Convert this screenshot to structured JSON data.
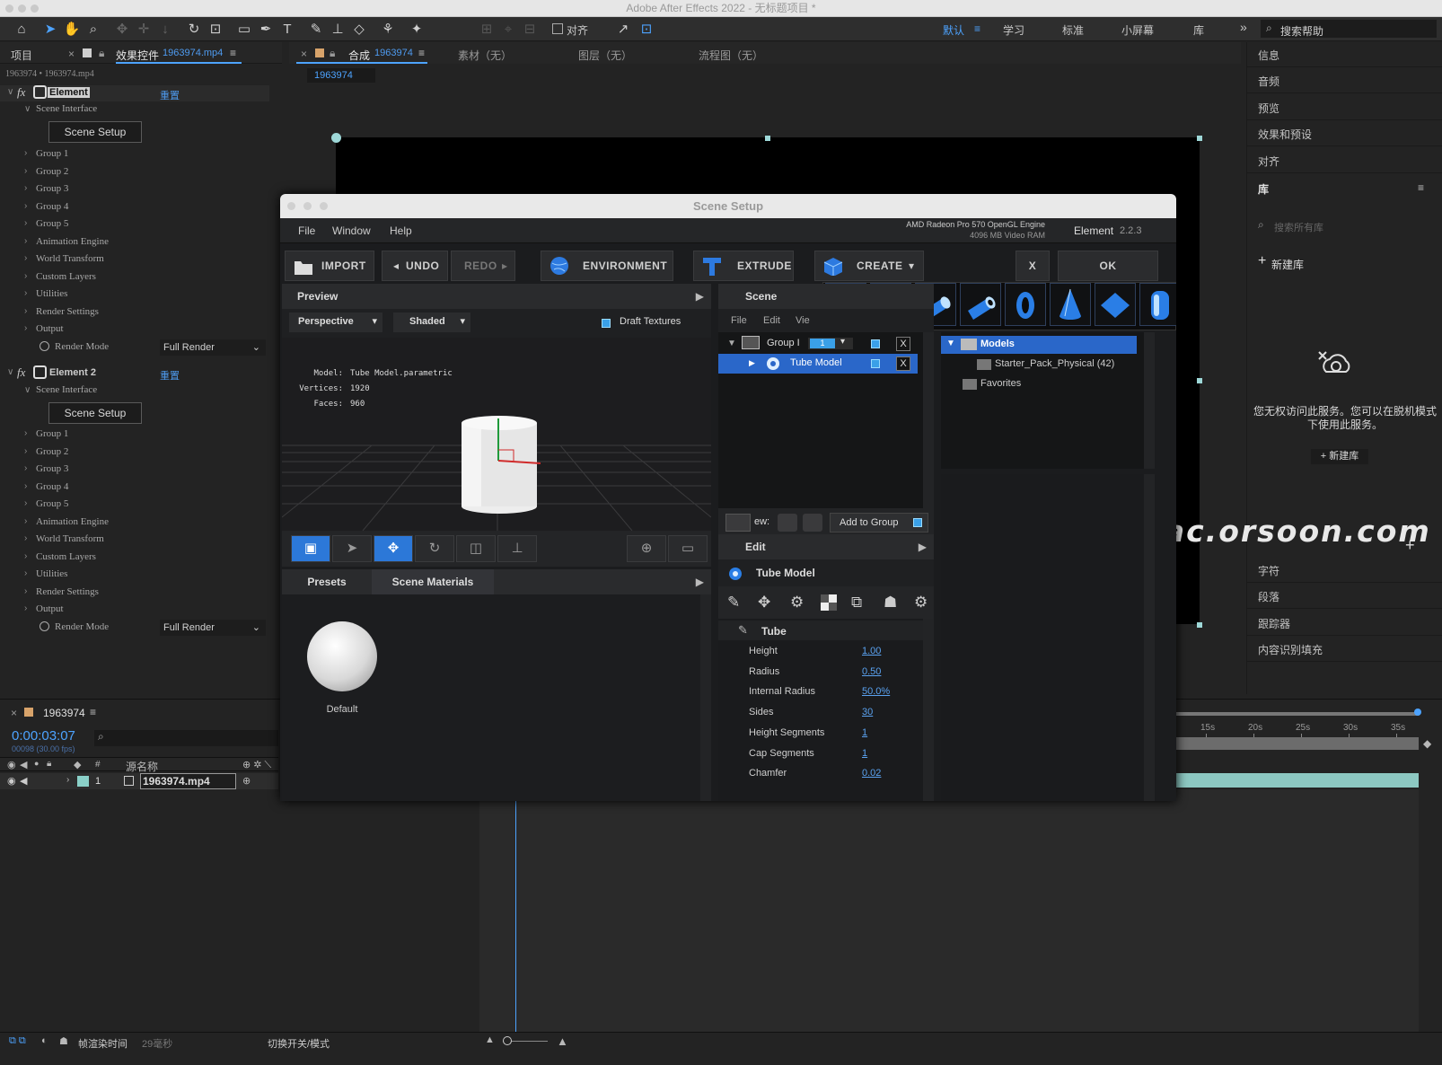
{
  "app": {
    "title": "Adobe After Effects 2022 - 无标题项目 *"
  },
  "toolbar": {
    "align_label": "对齐",
    "workspaces": [
      "默认",
      "学习",
      "标准",
      "小屏幕",
      "库"
    ],
    "more": "»",
    "search_placeholder": "搜索帮助"
  },
  "left_panel": {
    "tab_project": "项目",
    "tab_effects": "效果控件",
    "tab_effects_file": "1963974.mp4",
    "breadcrumb": "1963974 • 1963974.mp4",
    "element1": {
      "name": "Element",
      "reset": "重置",
      "scene_interface": "Scene Interface",
      "scene_setup": "Scene Setup",
      "items": [
        "Group 1",
        "Group 2",
        "Group 3",
        "Group 4",
        "Group 5",
        "Animation Engine",
        "World Transform",
        "Custom Layers",
        "Utilities",
        "Render Settings",
        "Output"
      ],
      "render_mode_label": "Render Mode",
      "render_mode_value": "Full Render"
    },
    "element2": {
      "name": "Element 2",
      "reset": "重置",
      "scene_interface": "Scene Interface",
      "scene_setup": "Scene Setup",
      "items": [
        "Group 1",
        "Group 2",
        "Group 3",
        "Group 4",
        "Group 5",
        "Animation Engine",
        "World Transform",
        "Custom Layers",
        "Utilities",
        "Render Settings",
        "Output"
      ],
      "render_mode_label": "Render Mode",
      "render_mode_value": "Full Render"
    }
  },
  "comp": {
    "tab_comp": "合成",
    "tab_comp_name": "1963974",
    "tab_footage": "素材（无）",
    "tab_layer": "图层（无）",
    "tab_flow": "流程图（无）",
    "comp_chip": "1963974"
  },
  "right_panel": {
    "items_top": [
      "信息",
      "音频",
      "预览",
      "效果和预设",
      "对齐"
    ],
    "library_title": "库",
    "library_search_placeholder": "搜索所有库",
    "new_library": "新建库",
    "no_access_text": "您无权访问此服务。您可以在脱机模式下使用此服务。",
    "new_library_btn": "+ 新建库",
    "items_bottom": [
      "字符",
      "段落",
      "跟踪器",
      "内容识别填充"
    ]
  },
  "timeline": {
    "comp_name": "1963974",
    "timecode": "0:00:03:07",
    "fps": "00098 (30.00 fps)",
    "col_num": "#",
    "col_source": "源名称",
    "layer_num": "1",
    "layer_name": "1963974.mp4",
    "ruler": [
      "15s",
      "20s",
      "25s",
      "30s",
      "35s"
    ],
    "bottom_label": "帧渲染时间",
    "bottom_time": "29毫秒",
    "bottom_toggle": "切换开关/模式"
  },
  "watermark": "Mac.orsoon.com",
  "dialog": {
    "title": "Scene Setup",
    "menu": [
      "File",
      "Window",
      "Help"
    ],
    "gpu_line1": "AMD Radeon Pro 570 OpenGL Engine",
    "gpu_line2": "4096 MB Video RAM",
    "product": "Element",
    "version": "2.2.3",
    "buttons": {
      "import": "IMPORT",
      "undo": "UNDO",
      "redo": "REDO",
      "environment": "ENVIRONMENT",
      "extrude": "EXTRUDE",
      "create": "CREATE",
      "close": "X",
      "ok": "OK"
    },
    "preview": {
      "title": "Preview",
      "view": "Perspective",
      "shading": "Shaded",
      "draft": "Draft Textures",
      "stats": [
        [
          "Model:",
          "Tube Model.parametric"
        ],
        [
          "Vertices:",
          "1920"
        ],
        [
          "Faces:",
          "960"
        ]
      ]
    },
    "presets": {
      "tab_presets": "Presets",
      "tab_materials": "Scene Materials",
      "default_material": "Default"
    },
    "scene": {
      "title": "Scene",
      "menu": [
        "File",
        "Edit",
        "Vie"
      ],
      "group": "Group I",
      "group_num": "1",
      "model": "Tube Model",
      "view_label": "ew:",
      "add_to_group": "Add to Group"
    },
    "models": {
      "root": "Models",
      "child": "Starter_Pack_Physical (42)",
      "favorites": "Favorites"
    },
    "edit": {
      "title": "Edit",
      "object": "Tube Model",
      "section": "Tube",
      "params": [
        [
          "Height",
          "1.00"
        ],
        [
          "Radius",
          "0.50"
        ],
        [
          "Internal Radius",
          "50.0%"
        ],
        [
          "Sides",
          "30"
        ],
        [
          "Height Segments",
          "1"
        ],
        [
          "Cap Segments",
          "1"
        ],
        [
          "Chamfer",
          "0.02"
        ]
      ]
    }
  }
}
